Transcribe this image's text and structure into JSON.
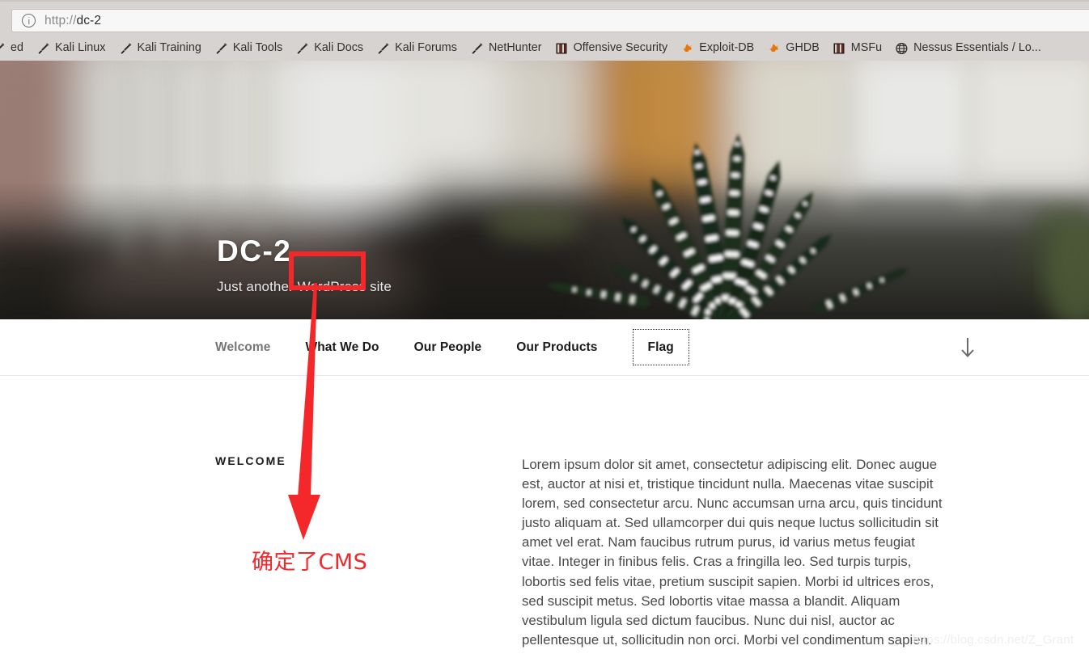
{
  "browser": {
    "url_scheme": "http://",
    "url_host": "dc-2",
    "url_full": "http://dc-2",
    "info_icon": "info-circle-icon",
    "bookmarks": [
      {
        "label": "ed",
        "icon": "kali-sword-icon"
      },
      {
        "label": "Kali Linux",
        "icon": "kali-sword-icon"
      },
      {
        "label": "Kali Training",
        "icon": "kali-sword-icon"
      },
      {
        "label": "Kali Tools",
        "icon": "kali-sword-icon"
      },
      {
        "label": "Kali Docs",
        "icon": "kali-sword-icon"
      },
      {
        "label": "Kali Forums",
        "icon": "kali-sword-icon"
      },
      {
        "label": "NetHunter",
        "icon": "kali-sword-icon"
      },
      {
        "label": "Offensive Security",
        "icon": "book-icon"
      },
      {
        "label": "Exploit-DB",
        "icon": "flame-icon"
      },
      {
        "label": "GHDB",
        "icon": "flame-icon"
      },
      {
        "label": "MSFu",
        "icon": "book-icon"
      },
      {
        "label": "Nessus Essentials / Lo...",
        "icon": "globe-icon"
      }
    ]
  },
  "hero": {
    "title": "DC-2",
    "tagline": "Just another WordPress site",
    "tagline_prefix": "Just another ",
    "tagline_highlight": "WordPress",
    "tagline_suffix": " site"
  },
  "nav": {
    "items": [
      {
        "label": "Welcome",
        "state": "current"
      },
      {
        "label": "What We Do",
        "state": "default"
      },
      {
        "label": "Our People",
        "state": "default"
      },
      {
        "label": "Our Products",
        "state": "default"
      },
      {
        "label": "Flag",
        "state": "focused"
      }
    ],
    "scroll_icon": "arrow-down-icon"
  },
  "content": {
    "section_heading": "WELCOME",
    "paragraph": "Lorem ipsum dolor sit amet, consectetur adipiscing elit. Donec augue est, auctor at nisi et, tristique tincidunt nulla. Maecenas vitae suscipit lorem, sed consectetur arcu. Nunc accumsan urna arcu, quis tincidunt justo aliquam at. Sed ullamcorper dui quis neque luctus sollicitudin sit amet vel erat. Nam faucibus rutrum purus, id varius metus feugiat vitae. Integer in finibus felis. Cras a fringilla leo. Sed turpis turpis, lobortis sed felis vitae, pretium suscipit sapien. Morbi id ultrices eros, sed suscipit metus. Sed lobortis vitae massa a blandit. Aliquam vestibulum ligula sed dictum faucibus. Nunc dui nisl, auctor ac pellentesque ut, sollicitudin non orci. Morbi vel condimentum sapien."
  },
  "annotations": {
    "highlight_color": "#f4282a",
    "note_text": "确定了CMS",
    "arrow_icon": "red-arrow-down",
    "rect_target": "WordPress"
  },
  "watermark": {
    "text": "https://blog.csdn.net/Z_Grant"
  }
}
